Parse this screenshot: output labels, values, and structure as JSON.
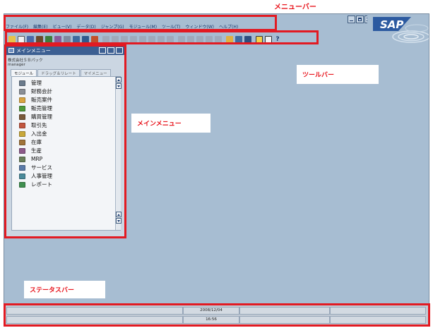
{
  "callouts": {
    "menubar": "メニューバー",
    "toolbar": "ツールバー",
    "main_menu": "メインメニュー",
    "statusbar": "ステータスバー"
  },
  "logo": {
    "text": "SAP"
  },
  "menubar": {
    "items": [
      "ファイル(F)",
      "編集(E)",
      "ビュー(V)",
      "データ(D)",
      "ジャンプ(G)",
      "モジュール(M)",
      "ツール(T)",
      "ウィンドウ(W)",
      "ヘルプ(H)"
    ]
  },
  "toolbar": {
    "icons": [
      "new-document-icon",
      "open-icon",
      "save-icon",
      "print-icon",
      "find-icon",
      "preview-icon",
      "first-record-icon",
      "previous-record-icon",
      "next-record-icon",
      "last-record-icon",
      "filter-icon",
      "sort-icon",
      "refresh-icon",
      "settings-icon",
      "alert-icon",
      "help-icon"
    ],
    "help_label": "?"
  },
  "main_menu": {
    "title": "メインメニュー",
    "company": "株式会社ＳＢパック",
    "user": "manager",
    "tabs": [
      "モジュール",
      "ドラッグ＆リレート",
      "マイメニュー"
    ],
    "items": [
      {
        "label": "管理",
        "icon": "administration-icon",
        "color": "#6b7b8c"
      },
      {
        "label": "財務会計",
        "icon": "financials-icon",
        "color": "#8a8f96"
      },
      {
        "label": "販売案件",
        "icon": "opportunities-icon",
        "color": "#d9a441"
      },
      {
        "label": "販売管理",
        "icon": "sales-icon",
        "color": "#4f9a3a"
      },
      {
        "label": "購買管理",
        "icon": "purchasing-icon",
        "color": "#7a5a3a"
      },
      {
        "label": "取引先",
        "icon": "business-partners-icon",
        "color": "#c2563f"
      },
      {
        "label": "入出金",
        "icon": "banking-icon",
        "color": "#c9a83a"
      },
      {
        "label": "在庫",
        "icon": "inventory-icon",
        "color": "#a0743a"
      },
      {
        "label": "生産",
        "icon": "production-icon",
        "color": "#8d5a8a"
      },
      {
        "label": "MRP",
        "icon": "mrp-icon",
        "color": "#6a7f5a"
      },
      {
        "label": "サービス",
        "icon": "service-icon",
        "color": "#5a7aa8"
      },
      {
        "label": "人事管理",
        "icon": "human-resources-icon",
        "color": "#4a8a9a"
      },
      {
        "label": "レポート",
        "icon": "reports-icon",
        "color": "#3f8f4f"
      }
    ]
  },
  "statusbar": {
    "date": "2008/12/04",
    "time": "16:56"
  },
  "colors": {
    "desktop": "#a7bdd2",
    "highlight": "#e21a22",
    "callout_text": "#e8141c",
    "titlebar": "#3c5f92"
  }
}
